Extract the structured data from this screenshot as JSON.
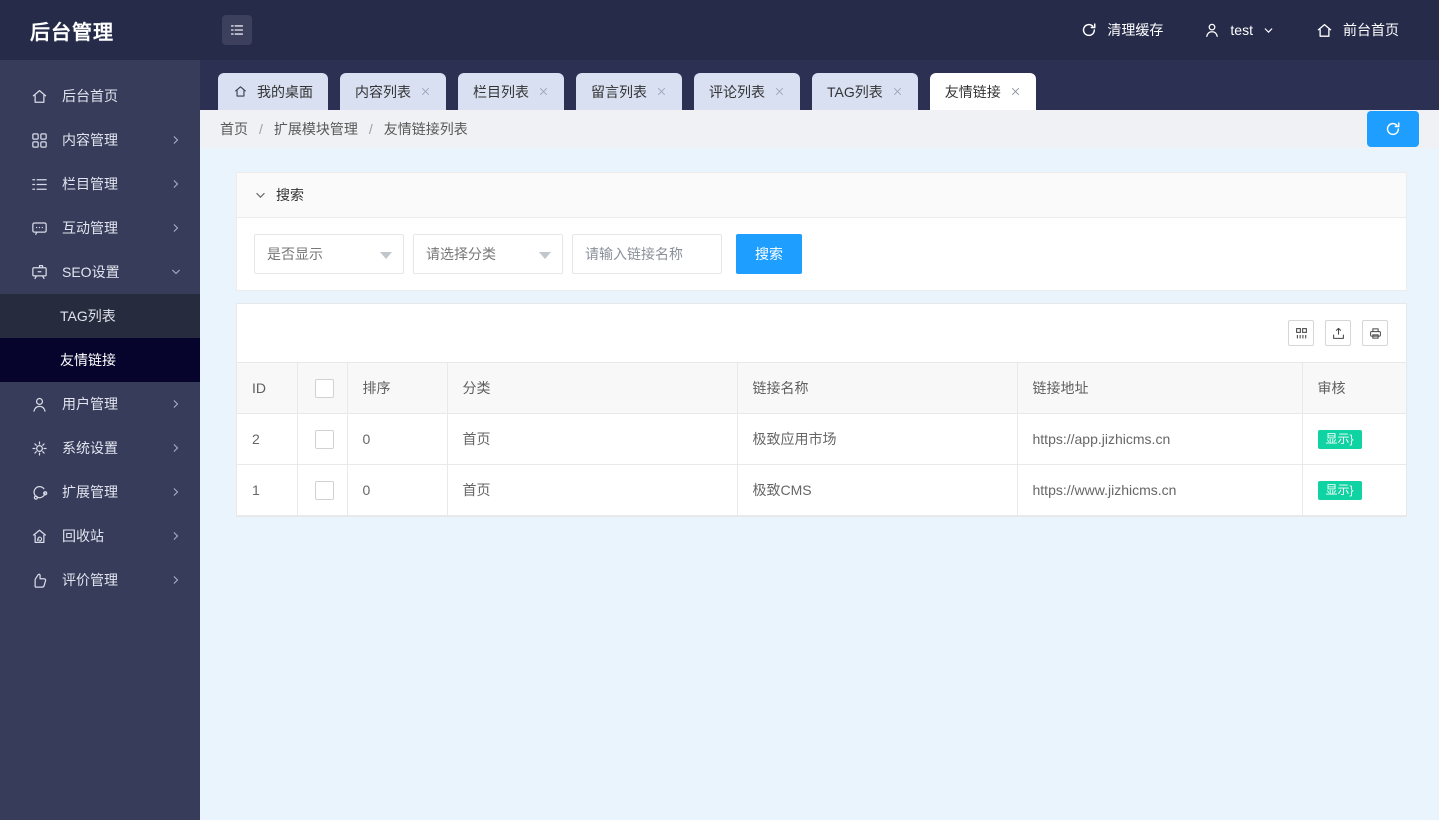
{
  "app": {
    "title": "后台管理"
  },
  "topbar": {
    "clear_cache": "清理缓存",
    "username": "test",
    "front_home": "前台首页"
  },
  "sidebar": {
    "items": [
      {
        "label": "后台首页"
      },
      {
        "label": "内容管理"
      },
      {
        "label": "栏目管理"
      },
      {
        "label": "互动管理"
      },
      {
        "label": "SEO设置"
      },
      {
        "label": "用户管理"
      },
      {
        "label": "系统设置"
      },
      {
        "label": "扩展管理"
      },
      {
        "label": "回收站"
      },
      {
        "label": "评价管理"
      }
    ],
    "seo_submenu": [
      {
        "label": "TAG列表",
        "active": false
      },
      {
        "label": "友情链接",
        "active": true
      }
    ]
  },
  "tabs": [
    {
      "label": "我的桌面",
      "closable": false,
      "active": false
    },
    {
      "label": "内容列表",
      "closable": true,
      "active": false
    },
    {
      "label": "栏目列表",
      "closable": true,
      "active": false
    },
    {
      "label": "留言列表",
      "closable": true,
      "active": false
    },
    {
      "label": "评论列表",
      "closable": true,
      "active": false
    },
    {
      "label": "TAG列表",
      "closable": true,
      "active": false
    },
    {
      "label": "友情链接",
      "closable": true,
      "active": true
    }
  ],
  "breadcrumb": {
    "separator": "/",
    "items": [
      "首页",
      "扩展模块管理",
      "友情链接列表"
    ]
  },
  "search_panel": {
    "title": "搜索",
    "display_filter_value": "是否显示",
    "category_filter_value": "请选择分类",
    "name_placeholder": "请输入链接名称",
    "submit_label": "搜索"
  },
  "table": {
    "headers": {
      "id": "ID",
      "order": "排序",
      "category": "分类",
      "name": "链接名称",
      "url": "链接地址",
      "audit": "审核"
    },
    "rows": [
      {
        "id": "2",
        "order": "0",
        "category": "首页",
        "name": "极致应用市场",
        "url": "https://app.jizhicms.cn",
        "status": "显示}"
      },
      {
        "id": "1",
        "order": "0",
        "category": "首页",
        "name": "极致CMS",
        "url": "https://www.jizhicms.cn",
        "status": "显示}"
      }
    ]
  },
  "colors": {
    "accent_blue": "#1e9fff",
    "badge_green": "#0fd3a2",
    "topbar_navy": "#262b4a",
    "sidebar_navy": "#363c59",
    "active_item_navy": "#06042c"
  }
}
